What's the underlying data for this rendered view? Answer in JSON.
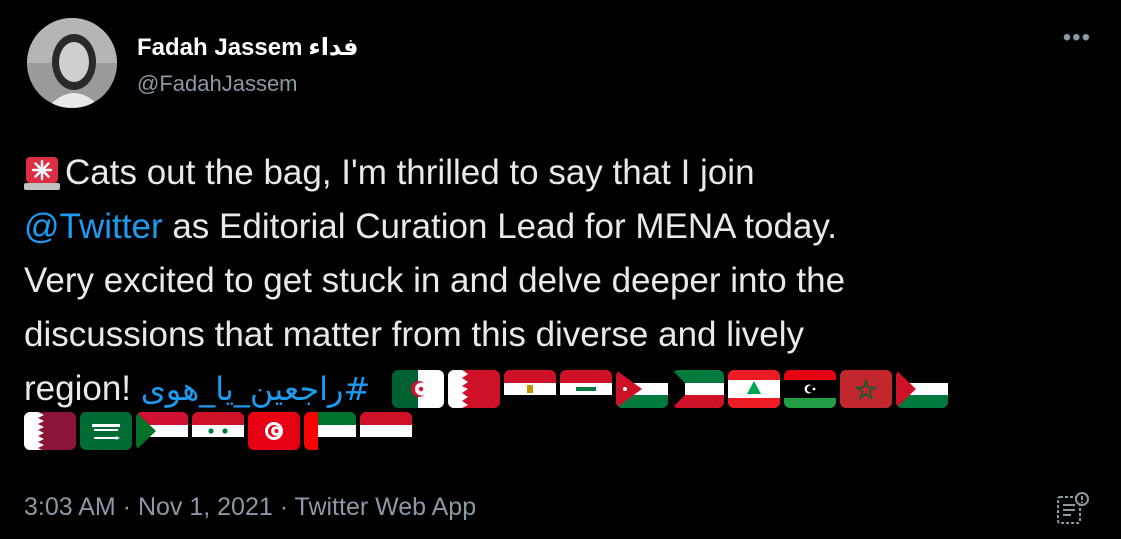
{
  "user": {
    "display_name": "Fadah Jassem",
    "display_name_ar": "فداء",
    "handle": "@FadahJassem"
  },
  "menu": {
    "more_label": "•••"
  },
  "tweet": {
    "line1_text": "Cats out the bag, I'm thrilled to say that I join",
    "mention": "@Twitter",
    "line2_text": " as Editorial Curation Lead for MENA today.",
    "line3_text": "Very excited to get stuck in and delve deeper into the",
    "line4_text": "discussions that matter from this diverse and lively",
    "line5_text": "region! ",
    "hashtag": "#راجعين_يا_هوى",
    "emoji": "siren",
    "flags_row1": [
      "Algeria",
      "Bahrain",
      "Egypt",
      "Iraq",
      "Jordan",
      "Kuwait",
      "Lebanon",
      "Libya",
      "Morocco",
      "Palestine"
    ],
    "flags_row2": [
      "Qatar",
      "Saudi Arabia",
      "Sudan",
      "Syria",
      "Tunisia",
      "United Arab Emirates",
      "Yemen"
    ]
  },
  "meta": {
    "time": "3:03 AM",
    "separator": " · ",
    "date": "Nov 1, 2021",
    "source": "Twitter Web App"
  },
  "icons": {
    "analytics": "analytics-icon",
    "more": "more-icon",
    "siren": "siren-icon"
  },
  "colors": {
    "background": "#000000",
    "link": "#1d9bf0",
    "text": "#e7e9ea",
    "muted": "#8b98a5"
  }
}
